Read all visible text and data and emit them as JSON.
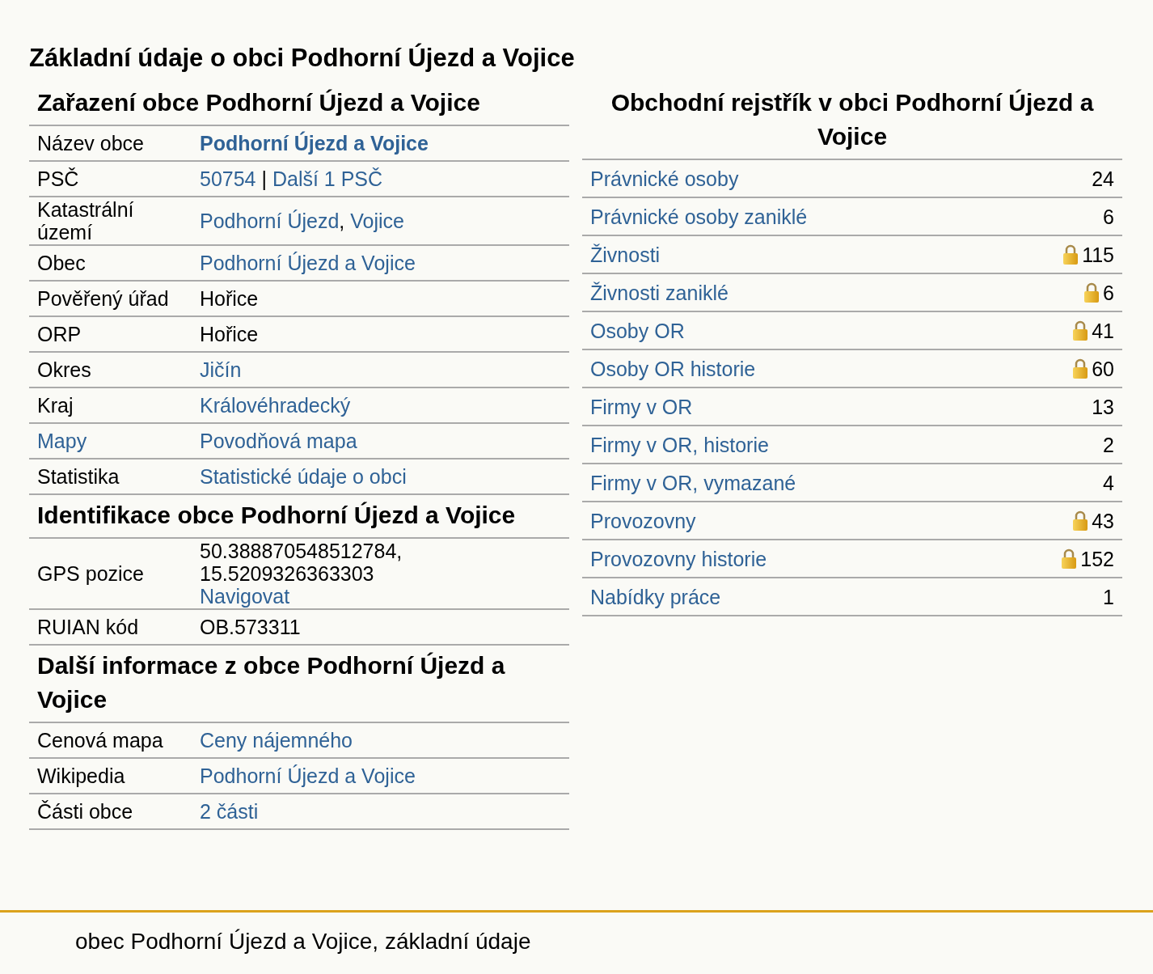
{
  "page_title": "Základní údaje o obci Podhorní Újezd a Vojice",
  "sections": [
    {
      "title": "Zařazení obce Podhorní Újezd a Vojice",
      "rows": [
        {
          "label": {
            "text": "Název obce",
            "link": false
          },
          "bold": true,
          "lines": [
            [
              {
                "text": "Podhorní Újezd a Vojice",
                "link": true
              }
            ]
          ]
        },
        {
          "label": {
            "text": "PSČ",
            "link": false
          },
          "bold": false,
          "lines": [
            [
              {
                "text": "50754",
                "link": true
              },
              {
                "text": " | ",
                "link": false
              },
              {
                "text": "Další 1 PSČ",
                "link": true
              }
            ]
          ]
        },
        {
          "label": {
            "text": "Katastrální území",
            "link": false
          },
          "bold": false,
          "lines": [
            [
              {
                "text": "Podhorní Újezd",
                "link": true
              },
              {
                "text": ", ",
                "link": false
              },
              {
                "text": "Vojice",
                "link": true
              }
            ]
          ]
        },
        {
          "label": {
            "text": "Obec",
            "link": false
          },
          "bold": false,
          "lines": [
            [
              {
                "text": "Podhorní Újezd a Vojice",
                "link": true
              }
            ]
          ]
        },
        {
          "label": {
            "text": "Pověřený úřad",
            "link": false
          },
          "bold": false,
          "lines": [
            [
              {
                "text": "Hořice",
                "link": false
              }
            ]
          ]
        },
        {
          "label": {
            "text": "ORP",
            "link": false
          },
          "bold": false,
          "lines": [
            [
              {
                "text": "Hořice",
                "link": false
              }
            ]
          ]
        },
        {
          "label": {
            "text": "Okres",
            "link": false
          },
          "bold": false,
          "lines": [
            [
              {
                "text": "Jičín",
                "link": true
              }
            ]
          ]
        },
        {
          "label": {
            "text": "Kraj",
            "link": false
          },
          "bold": false,
          "lines": [
            [
              {
                "text": "Královéhradecký",
                "link": true
              }
            ]
          ]
        },
        {
          "label": {
            "text": "Mapy",
            "link": true
          },
          "bold": false,
          "lines": [
            [
              {
                "text": "Povodňová mapa",
                "link": true
              }
            ]
          ]
        },
        {
          "label": {
            "text": "Statistika",
            "link": false
          },
          "bold": false,
          "lines": [
            [
              {
                "text": "Statistické údaje o obci",
                "link": true
              }
            ]
          ]
        }
      ]
    },
    {
      "title": "Identifikace obce Podhorní Újezd a Vojice",
      "rows": [
        {
          "label": {
            "text": "GPS pozice",
            "link": false
          },
          "bold": false,
          "lines": [
            [
              {
                "text": "50.388870548512784,",
                "link": false
              }
            ],
            [
              {
                "text": "15.5209326363303",
                "link": false
              }
            ],
            [
              {
                "text": "Navigovat",
                "link": true
              }
            ]
          ]
        },
        {
          "label": {
            "text": "RUIAN kód",
            "link": false
          },
          "bold": false,
          "lines": [
            [
              {
                "text": "OB.573311",
                "link": false
              }
            ]
          ]
        }
      ]
    },
    {
      "title": "Další informace z obce Podhorní Újezd a Vojice",
      "rows": [
        {
          "label": {
            "text": "Cenová mapa",
            "link": false
          },
          "bold": false,
          "lines": [
            [
              {
                "text": "Ceny nájemného",
                "link": true
              }
            ]
          ]
        },
        {
          "label": {
            "text": "Wikipedia",
            "link": false
          },
          "bold": false,
          "lines": [
            [
              {
                "text": "Podhorní Újezd a Vojice",
                "link": true
              }
            ]
          ]
        },
        {
          "label": {
            "text": "Části obce",
            "link": false
          },
          "bold": false,
          "lines": [
            [
              {
                "text": "2 části",
                "link": true
              }
            ]
          ]
        }
      ]
    }
  ],
  "register": {
    "title": "Obchodní rejstřík v obci Podhorní Újezd a Vojice",
    "rows": [
      {
        "label": "Právnické osoby",
        "count": "24",
        "locked": false
      },
      {
        "label": "Právnické osoby zaniklé",
        "count": "6",
        "locked": false
      },
      {
        "label": "Živnosti",
        "count": "115",
        "locked": true
      },
      {
        "label": "Živnosti zaniklé",
        "count": "6",
        "locked": true
      },
      {
        "label": "Osoby OR",
        "count": "41",
        "locked": true
      },
      {
        "label": "Osoby OR historie",
        "count": "60",
        "locked": true
      },
      {
        "label": "Firmy v OR",
        "count": "13",
        "locked": false
      },
      {
        "label": "Firmy v OR, historie",
        "count": "2",
        "locked": false
      },
      {
        "label": "Firmy v OR, vymazané",
        "count": "4",
        "locked": false
      },
      {
        "label": "Provozovny",
        "count": "43",
        "locked": true
      },
      {
        "label": "Provozovny historie",
        "count": "152",
        "locked": true
      },
      {
        "label": "Nabídky práce",
        "count": "1",
        "locked": false
      }
    ]
  },
  "footer": "obec Podhorní Újezd a Vojice, základní údaje"
}
